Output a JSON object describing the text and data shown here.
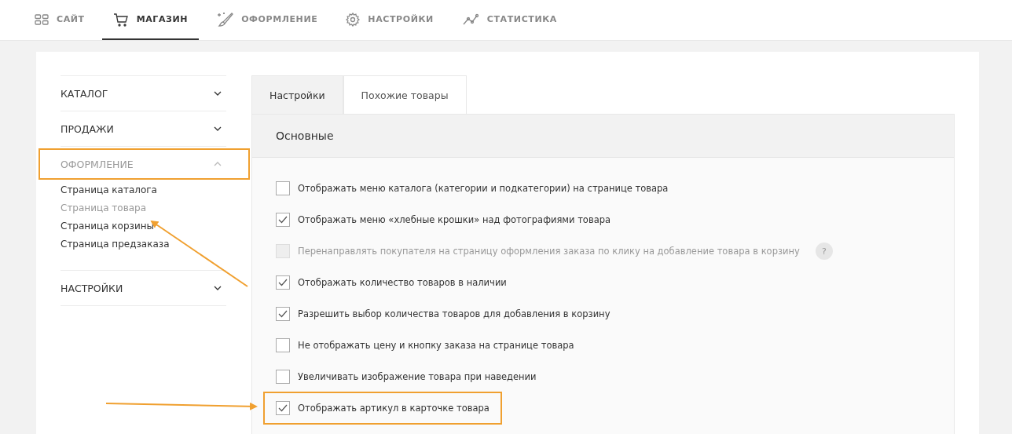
{
  "top_nav": [
    {
      "label": "САЙТ",
      "selected": false
    },
    {
      "label": "МАГАЗИН",
      "selected": true
    },
    {
      "label": "ОФОРМЛЕНИЕ",
      "selected": false
    },
    {
      "label": "НАСТРОЙКИ",
      "selected": false
    },
    {
      "label": "СТАТИСТИКА",
      "selected": false
    }
  ],
  "sidebar": {
    "sections": [
      {
        "label": "КАТАЛОГ",
        "expanded": false,
        "highlighted": false
      },
      {
        "label": "ПРОДАЖИ",
        "expanded": false,
        "highlighted": false
      },
      {
        "label": "ОФОРМЛЕНИЕ",
        "expanded": true,
        "highlighted": true,
        "children": [
          {
            "label": "Страница каталога",
            "selected": false
          },
          {
            "label": "Страница товара",
            "selected": true
          },
          {
            "label": "Страница корзины",
            "selected": false
          },
          {
            "label": "Страница предзаказа",
            "selected": false
          }
        ]
      },
      {
        "label": "НАСТРОЙКИ",
        "expanded": false,
        "highlighted": false
      }
    ]
  },
  "tabs": [
    {
      "label": "Настройки",
      "selected": true
    },
    {
      "label": "Похожие товары",
      "selected": false
    }
  ],
  "panel": {
    "title": "Основные",
    "options": [
      {
        "label": "Отображать меню каталога (категории и подкатегории) на странице товара",
        "checked": false,
        "disabled": false,
        "highlighted": false
      },
      {
        "label": "Отображать меню «хлебные крошки» над фотографиями товара",
        "checked": true,
        "disabled": false,
        "highlighted": false
      },
      {
        "label": "Перенаправлять покупателя на страницу оформления заказа по клику на добавление товара в корзину",
        "checked": false,
        "disabled": true,
        "highlighted": false,
        "help": "?"
      },
      {
        "label": "Отображать количество товаров в наличии",
        "checked": true,
        "disabled": false,
        "highlighted": false
      },
      {
        "label": "Разрешить выбор количества товаров для добавления в корзину",
        "checked": true,
        "disabled": false,
        "highlighted": false
      },
      {
        "label": "Не отображать цену и кнопку заказа на странице товара",
        "checked": false,
        "disabled": false,
        "highlighted": false
      },
      {
        "label": "Увеличивать изображение товара при наведении",
        "checked": false,
        "disabled": false,
        "highlighted": false
      },
      {
        "label": "Отображать артикул в карточке товара",
        "checked": true,
        "disabled": false,
        "highlighted": true
      }
    ]
  }
}
